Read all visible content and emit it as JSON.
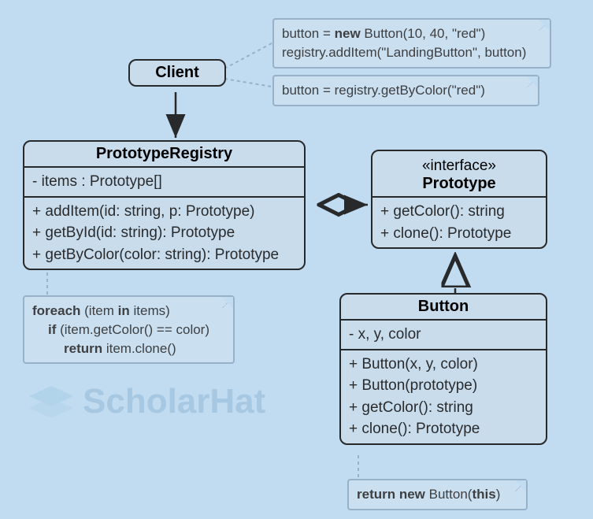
{
  "client": {
    "title": "Client"
  },
  "note_client1": {
    "line1a": "button = ",
    "line1b": "new",
    "line1c": " Button(10, 40, \"red\")",
    "line2": "registry.addItem(\"LandingButton\", button)"
  },
  "note_client2": {
    "line1": "button = registry.getByColor(\"red\")"
  },
  "registry": {
    "title": "PrototypeRegistry",
    "attr1": "- items : Prototype[]",
    "op1": "+ addItem(id: string, p: Prototype)",
    "op2": "+ getById(id: string): Prototype",
    "op3": "+ getByColor(color: string): Prototype"
  },
  "note_registry": {
    "l1a": "foreach",
    "l1b": " (item ",
    "l1c": "in",
    "l1d": " items)",
    "l2a": "if",
    "l2b": " (item.getColor() == color)",
    "l3a": "return",
    "l3b": " item.clone()"
  },
  "prototype": {
    "stereotype": "«interface»",
    "title": "Prototype",
    "op1": "+ getColor(): string",
    "op2": "+ clone(): Prototype"
  },
  "button": {
    "title": "Button",
    "attr1": "- x, y, color",
    "op1": "+ Button(x, y, color)",
    "op2": "+ Button(prototype)",
    "op3": "+ getColor(): string",
    "op4": "+ clone(): Prototype"
  },
  "note_button": {
    "l1a": "return new",
    "l1b": " Button(",
    "l1c": "this",
    "l1d": ")"
  },
  "watermark": "ScholarHat"
}
